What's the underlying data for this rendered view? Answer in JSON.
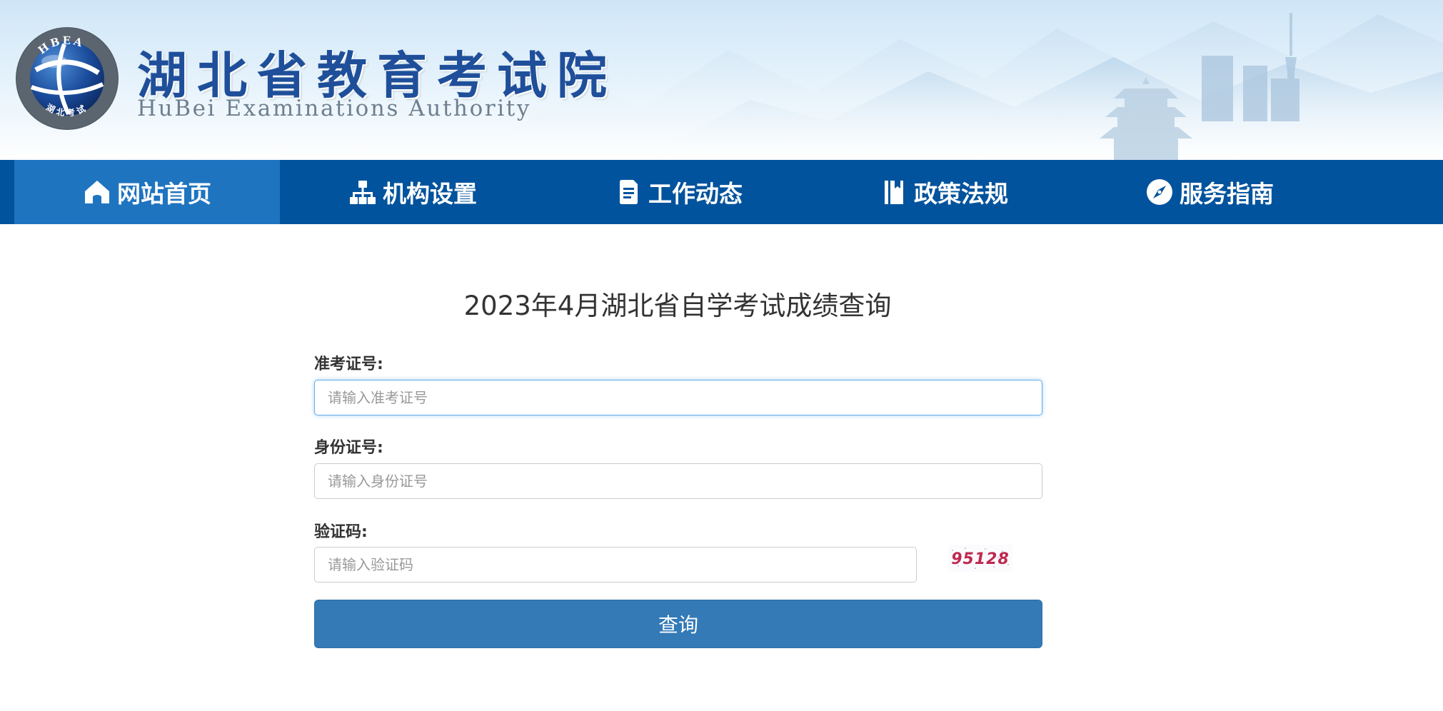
{
  "header": {
    "title": "湖北省教育考试院",
    "subtitle": "HuBei Examinations Authority",
    "logo_arc_text": "HBEA",
    "logo_bottom_text": "湖北考试"
  },
  "nav": {
    "items": [
      {
        "label": "网站首页",
        "icon": "home-icon",
        "active": true
      },
      {
        "label": "机构设置",
        "icon": "sitemap-icon",
        "active": false
      },
      {
        "label": "工作动态",
        "icon": "document-icon",
        "active": false
      },
      {
        "label": "政策法规",
        "icon": "book-icon",
        "active": false
      },
      {
        "label": "服务指南",
        "icon": "compass-icon",
        "active": false
      }
    ]
  },
  "form": {
    "title": "2023年4月湖北省自学考试成绩查询",
    "exam_id": {
      "label": "准考证号:",
      "placeholder": "请输入准考证号",
      "value": ""
    },
    "id_card": {
      "label": "身份证号:",
      "placeholder": "请输入身份证号",
      "value": ""
    },
    "captcha": {
      "label": "验证码:",
      "placeholder": "请输入验证码",
      "value": "",
      "image_text": "95128"
    },
    "submit_label": "查询"
  },
  "colors": {
    "nav_bg": "#02539d",
    "nav_active": "#1f74bf",
    "button": "#337ab7",
    "title_blue": "#1f4f9a"
  }
}
